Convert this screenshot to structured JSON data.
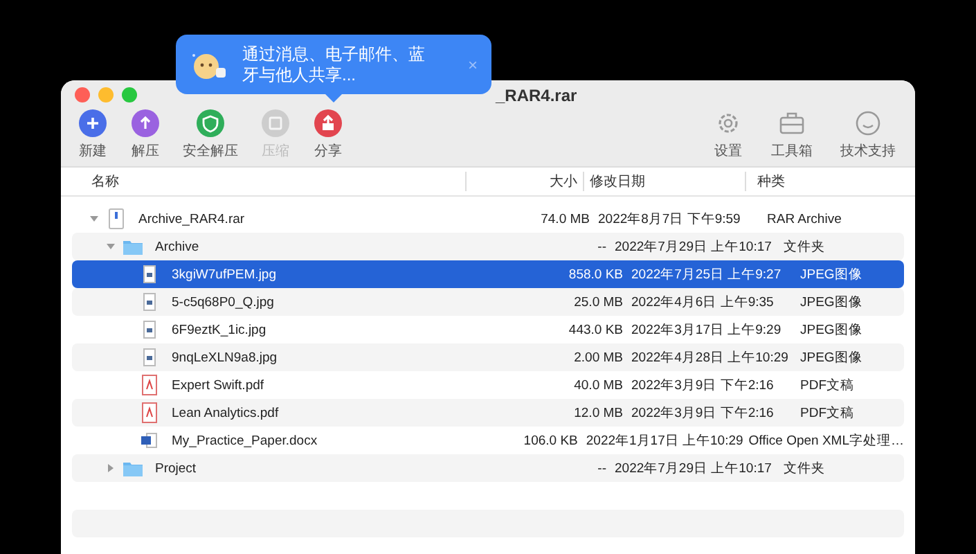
{
  "window": {
    "title": "_RAR4.rar"
  },
  "tooltip": {
    "text": "通过消息、电子邮件、蓝牙与他人共享...",
    "close": "×"
  },
  "toolbar": {
    "left": [
      {
        "label": "新建",
        "kind": "new",
        "color": "#4a6ee8",
        "disabled": false
      },
      {
        "label": "解压",
        "kind": "extract",
        "color": "#9a62e0",
        "disabled": false
      },
      {
        "label": "安全解压",
        "kind": "shield",
        "color": "#2fae5a",
        "disabled": false
      },
      {
        "label": "压缩",
        "kind": "compress",
        "color": "#b0b0b0",
        "disabled": true
      },
      {
        "label": "分享",
        "kind": "share",
        "color": "#e2454f",
        "disabled": false
      }
    ],
    "right": [
      {
        "label": "设置",
        "kind": "gear"
      },
      {
        "label": "工具箱",
        "kind": "toolbox"
      },
      {
        "label": "技术支持",
        "kind": "support"
      }
    ]
  },
  "table": {
    "columns": [
      "名称",
      "大小",
      "修改日期",
      "种类"
    ],
    "rows": [
      {
        "name": "Archive_RAR4.rar",
        "kind": "archive",
        "size": "74.0 MB",
        "date": "2022年8月7日 下午9:59",
        "type": "RAR Archive",
        "selected": false,
        "expanded": true,
        "children": [
          {
            "name": "Archive",
            "kind": "folder",
            "size": "--",
            "date": "2022年7月29日 上午10:17",
            "type": "文件夹",
            "selected": false,
            "expanded": true,
            "children": [
              {
                "name": "3kgiW7ufPEM.jpg",
                "kind": "image",
                "size": "858.0 KB",
                "date": "2022年7月25日 上午9:27",
                "type": "JPEG图像",
                "selected": true
              },
              {
                "name": "5-c5q68P0_Q.jpg",
                "kind": "image",
                "size": "25.0 MB",
                "date": "2022年4月6日 上午9:35",
                "type": "JPEG图像",
                "selected": false
              },
              {
                "name": "6F9eztK_1ic.jpg",
                "kind": "image",
                "size": "443.0 KB",
                "date": "2022年3月17日 上午9:29",
                "type": "JPEG图像",
                "selected": false
              },
              {
                "name": "9nqLeXLN9a8.jpg",
                "kind": "image",
                "size": "2.00 MB",
                "date": "2022年4月28日 上午10:29",
                "type": "JPEG图像",
                "selected": false
              },
              {
                "name": "Expert Swift.pdf",
                "kind": "pdf",
                "size": "40.0 MB",
                "date": "2022年3月9日 下午2:16",
                "type": "PDF文稿",
                "selected": false
              },
              {
                "name": "Lean Analytics.pdf",
                "kind": "pdf",
                "size": "12.0 MB",
                "date": "2022年3月9日 下午2:16",
                "type": "PDF文稿",
                "selected": false
              },
              {
                "name": "My_Practice_Paper.docx",
                "kind": "doc",
                "size": "106.0 KB",
                "date": "2022年1月17日 上午10:29",
                "type": "Office Open XML字处理…",
                "selected": false
              }
            ]
          },
          {
            "name": "Project",
            "kind": "folder",
            "size": "--",
            "date": "2022年7月29日 上午10:17",
            "type": "文件夹",
            "selected": false,
            "expanded": false
          }
        ]
      }
    ]
  }
}
